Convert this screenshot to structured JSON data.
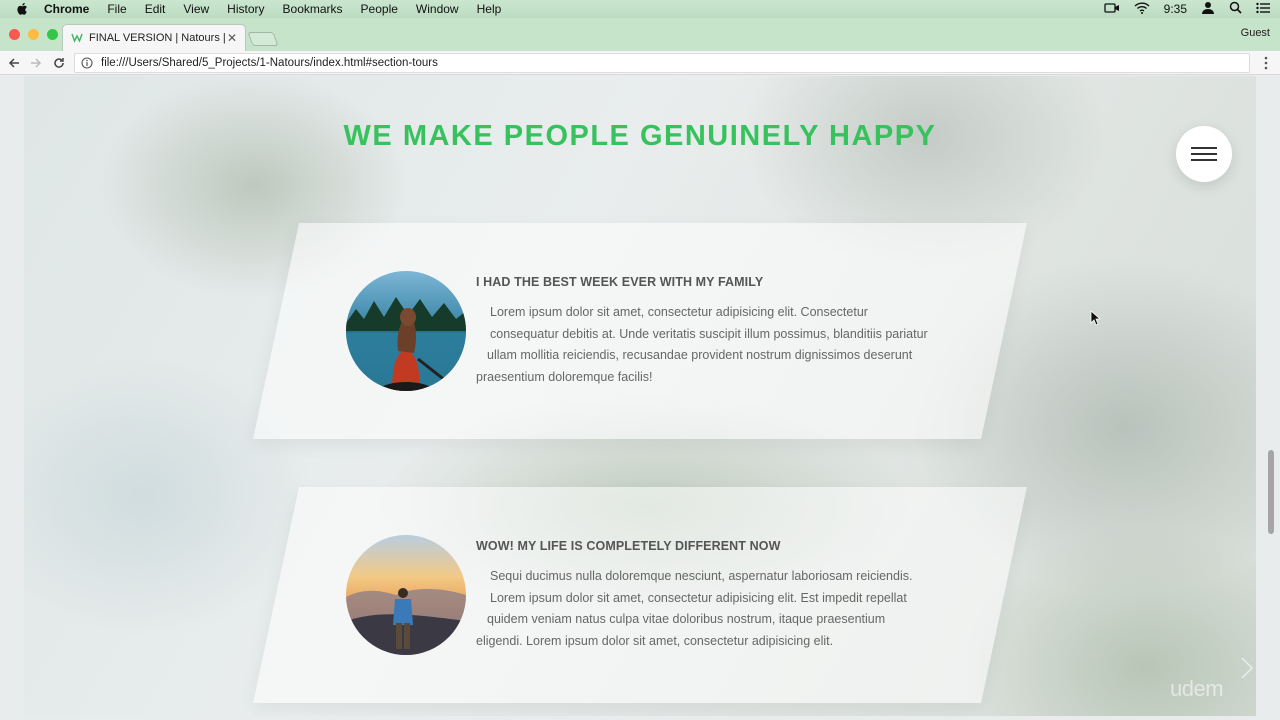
{
  "menubar": {
    "app_name": "Chrome",
    "items": [
      "File",
      "Edit",
      "View",
      "History",
      "Bookmarks",
      "People",
      "Window",
      "Help"
    ],
    "clock": "9:35"
  },
  "browser": {
    "tab_title": "FINAL VERSION | Natours | Ex",
    "guest_label": "Guest",
    "url": "file:///Users/Shared/5_Projects/1-Natours/index.html#section-tours"
  },
  "page": {
    "section_title": "WE MAKE PEOPLE GENUINELY HAPPY",
    "stories": [
      {
        "heading": "I HAD THE BEST WEEK EVER WITH MY FAMILY",
        "lines": [
          "Lorem ipsum dolor sit amet, consectetur adipisicing elit. Consectetur",
          "consequatur debitis at. Unde veritatis suscipit illum possimus, blanditiis pariatur",
          "ullam mollitia reiciendis, recusandae provident nostrum dignissimos deserunt",
          "praesentium doloremque facilis!"
        ]
      },
      {
        "heading": "WOW! MY LIFE IS COMPLETELY DIFFERENT NOW",
        "lines": [
          "Sequi ducimus nulla doloremque nesciunt, aspernatur laboriosam reiciendis.",
          "Lorem ipsum dolor sit amet, consectetur adipisicing elit. Est impedit repellat",
          "quidem veniam natus culpa vitae doloribus nostrum, itaque praesentium",
          "eligendi. Lorem ipsum dolor sit amet, consectetur adipisicing elit."
        ]
      }
    ],
    "watermark": "udem"
  },
  "icons": {
    "apple": "apple-icon",
    "wifi": "wifi-icon",
    "user": "user-icon",
    "search": "search-icon",
    "list": "list-icon",
    "camera": "camera-icon",
    "back": "back-arrow-icon",
    "forward": "forward-arrow-icon",
    "reload": "reload-icon",
    "info": "info-icon",
    "menu": "hamburger-icon"
  },
  "colors": {
    "accent": "#38c25d",
    "menubar": "#bcdcc2"
  }
}
